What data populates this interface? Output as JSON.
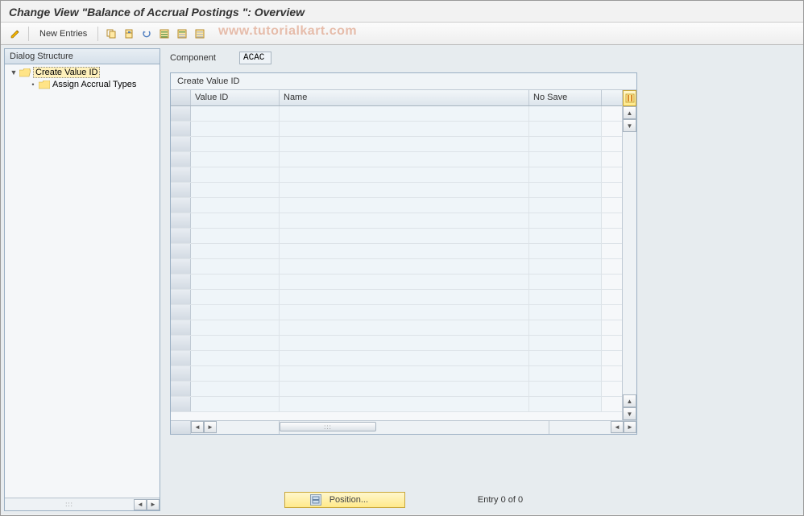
{
  "title": "Change View \"Balance of Accrual Postings \": Overview",
  "toolbar": {
    "new_entries_label": "New Entries"
  },
  "watermark": "www.tutorialkart.com",
  "sidebar": {
    "header": "Dialog Structure",
    "items": [
      {
        "label": "Create Value ID",
        "selected": true,
        "level": 1,
        "expanded": true,
        "folder": "open"
      },
      {
        "label": "Assign Accrual Types",
        "selected": false,
        "level": 2,
        "expanded": false,
        "folder": "closed"
      }
    ]
  },
  "field": {
    "component_label": "Component",
    "component_value": "ACAC"
  },
  "panel": {
    "title": "Create Value ID",
    "columns": {
      "value_id": "Value ID",
      "name": "Name",
      "no_save": "No Save"
    },
    "rows": [],
    "empty_row_count": 20
  },
  "footer": {
    "position_label": "Position...",
    "entry_text": "Entry 0 of 0"
  }
}
